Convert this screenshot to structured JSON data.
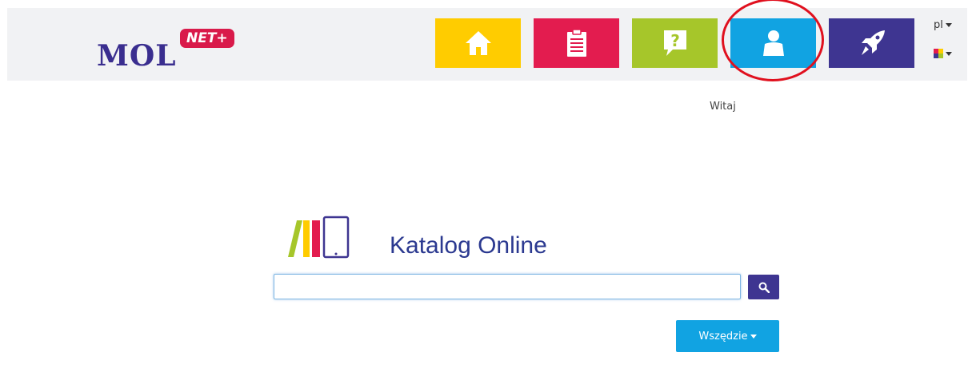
{
  "header": {
    "logo_text": "MOL",
    "logo_badge": "NET+",
    "nav": [
      {
        "name": "home",
        "icon": "home-icon",
        "color": "#ffcc00"
      },
      {
        "name": "list",
        "icon": "clipboard-icon",
        "color": "#e31c4f"
      },
      {
        "name": "help",
        "icon": "question-bubble-icon",
        "color": "#a6c62a"
      },
      {
        "name": "user",
        "icon": "user-icon",
        "color": "#11a3e2"
      },
      {
        "name": "rocket",
        "icon": "rocket-icon",
        "color": "#3e3591"
      }
    ],
    "language": "pl",
    "theme_colors": [
      "#e31c4f",
      "#ffcc00",
      "#3e3591",
      "#a6c62a"
    ]
  },
  "greeting": {
    "label": "Witaj"
  },
  "catalog": {
    "title": "Katalog Online",
    "search_value": "",
    "search_icon": "search-icon",
    "scope_label": "Wszędzie"
  },
  "annotation": {
    "highlight_color": "#e0101e"
  }
}
